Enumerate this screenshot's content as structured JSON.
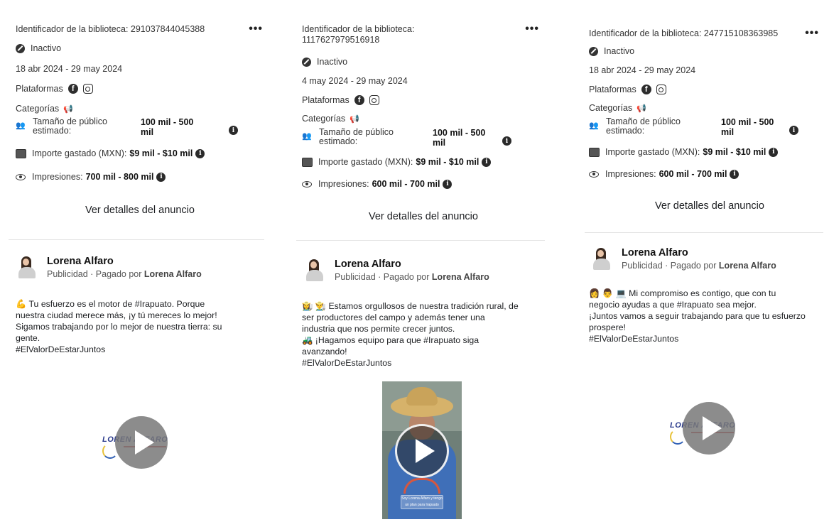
{
  "labels": {
    "platforms": "Plataformas",
    "categories": "Categorías",
    "audience": "Tamaño de público estimado:",
    "spend": "Importe gastado (MXN):",
    "impressions": "Impresiones:",
    "details": "Ver detalles del anuncio",
    "sponsored": "Publicidad · Pagado por",
    "more": "•••"
  },
  "cards": [
    {
      "library_id": "Identificador de la biblioteca: 291037844045388",
      "status": "Inactivo",
      "dates": "18 abr 2024 - 29 may 2024",
      "audience_size": "100 mil - 500 mil",
      "spend": "$9 mil - $10 mil",
      "impressions": "700 mil - 800 mil",
      "advertiser": "Lorena Alfaro",
      "paid_by": "Lorena Alfaro",
      "body": [
        "💪 Tu esfuerzo es el motor de #Irapuato. Porque",
        "nuestra ciudad merece más, ¡y tú mereces lo mejor!",
        "Sigamos trabajando por lo mejor de nuestra tierra: su",
        "gente.",
        "#ElValorDeEstarJuntos"
      ],
      "logo_text": "LOREN ALFARO"
    },
    {
      "library_id": "Identificador de la biblioteca: 1117627979516918",
      "status": "Inactivo",
      "dates": "4 may 2024 - 29 may 2024",
      "audience_size": "100 mil - 500 mil",
      "spend": "$9 mil - $10 mil",
      "impressions": "600 mil - 700 mil",
      "advertiser": "Lorena Alfaro",
      "paid_by": "Lorena Alfaro",
      "body": [
        "👩‍🌾 👨‍🌾 Estamos orgullosos de nuestra tradición rural, de",
        "ser productores del campo y además tener una",
        "industria que nos permite crecer juntos.",
        "🚜 ¡Hagamos equipo para que #Irapuato siga",
        "avanzando!",
        "#ElValorDeEstarJuntos"
      ],
      "video_caption": "Soy Lorena Alfaro y tengo un plan para Irapuato"
    },
    {
      "library_id": "Identificador de la biblioteca: 247715108363985",
      "status": "Inactivo",
      "dates": "18 abr 2024 - 29 may 2024",
      "audience_size": "100 mil - 500 mil",
      "spend": "$9 mil - $10 mil",
      "impressions": "600 mil - 700 mil",
      "advertiser": "Lorena Alfaro",
      "paid_by": "Lorena Alfaro",
      "body": [
        "👩 👨 💻 Mi compromiso es contigo, que con tu",
        "negocio ayudas a que #Irapuato sea mejor.",
        "¡Juntos vamos a seguir trabajando para que tu esfuerzo",
        "prospere!",
        "#ElValorDeEstarJuntos"
      ],
      "logo_text": "LOREN ALFARO"
    }
  ]
}
